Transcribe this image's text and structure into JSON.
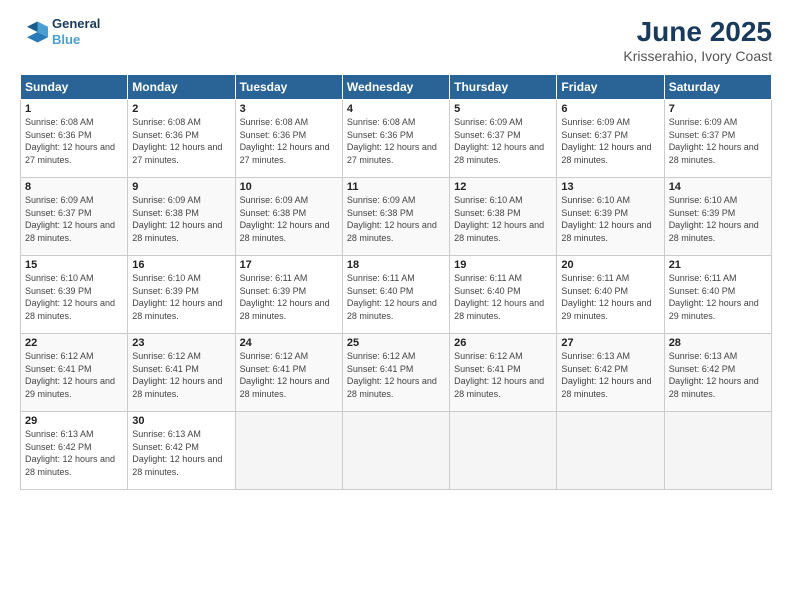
{
  "logo": {
    "line1": "General",
    "line2": "Blue"
  },
  "title": "June 2025",
  "subtitle": "Krisserahio, Ivory Coast",
  "days_of_week": [
    "Sunday",
    "Monday",
    "Tuesday",
    "Wednesday",
    "Thursday",
    "Friday",
    "Saturday"
  ],
  "weeks": [
    [
      {
        "num": "1",
        "sunrise": "6:08 AM",
        "sunset": "6:36 PM",
        "daylight": "12 hours and 27 minutes."
      },
      {
        "num": "2",
        "sunrise": "6:08 AM",
        "sunset": "6:36 PM",
        "daylight": "12 hours and 27 minutes."
      },
      {
        "num": "3",
        "sunrise": "6:08 AM",
        "sunset": "6:36 PM",
        "daylight": "12 hours and 27 minutes."
      },
      {
        "num": "4",
        "sunrise": "6:08 AM",
        "sunset": "6:36 PM",
        "daylight": "12 hours and 27 minutes."
      },
      {
        "num": "5",
        "sunrise": "6:09 AM",
        "sunset": "6:37 PM",
        "daylight": "12 hours and 28 minutes."
      },
      {
        "num": "6",
        "sunrise": "6:09 AM",
        "sunset": "6:37 PM",
        "daylight": "12 hours and 28 minutes."
      },
      {
        "num": "7",
        "sunrise": "6:09 AM",
        "sunset": "6:37 PM",
        "daylight": "12 hours and 28 minutes."
      }
    ],
    [
      {
        "num": "8",
        "sunrise": "6:09 AM",
        "sunset": "6:37 PM",
        "daylight": "12 hours and 28 minutes."
      },
      {
        "num": "9",
        "sunrise": "6:09 AM",
        "sunset": "6:38 PM",
        "daylight": "12 hours and 28 minutes."
      },
      {
        "num": "10",
        "sunrise": "6:09 AM",
        "sunset": "6:38 PM",
        "daylight": "12 hours and 28 minutes."
      },
      {
        "num": "11",
        "sunrise": "6:09 AM",
        "sunset": "6:38 PM",
        "daylight": "12 hours and 28 minutes."
      },
      {
        "num": "12",
        "sunrise": "6:10 AM",
        "sunset": "6:38 PM",
        "daylight": "12 hours and 28 minutes."
      },
      {
        "num": "13",
        "sunrise": "6:10 AM",
        "sunset": "6:39 PM",
        "daylight": "12 hours and 28 minutes."
      },
      {
        "num": "14",
        "sunrise": "6:10 AM",
        "sunset": "6:39 PM",
        "daylight": "12 hours and 28 minutes."
      }
    ],
    [
      {
        "num": "15",
        "sunrise": "6:10 AM",
        "sunset": "6:39 PM",
        "daylight": "12 hours and 28 minutes."
      },
      {
        "num": "16",
        "sunrise": "6:10 AM",
        "sunset": "6:39 PM",
        "daylight": "12 hours and 28 minutes."
      },
      {
        "num": "17",
        "sunrise": "6:11 AM",
        "sunset": "6:39 PM",
        "daylight": "12 hours and 28 minutes."
      },
      {
        "num": "18",
        "sunrise": "6:11 AM",
        "sunset": "6:40 PM",
        "daylight": "12 hours and 28 minutes."
      },
      {
        "num": "19",
        "sunrise": "6:11 AM",
        "sunset": "6:40 PM",
        "daylight": "12 hours and 28 minutes."
      },
      {
        "num": "20",
        "sunrise": "6:11 AM",
        "sunset": "6:40 PM",
        "daylight": "12 hours and 29 minutes."
      },
      {
        "num": "21",
        "sunrise": "6:11 AM",
        "sunset": "6:40 PM",
        "daylight": "12 hours and 29 minutes."
      }
    ],
    [
      {
        "num": "22",
        "sunrise": "6:12 AM",
        "sunset": "6:41 PM",
        "daylight": "12 hours and 29 minutes."
      },
      {
        "num": "23",
        "sunrise": "6:12 AM",
        "sunset": "6:41 PM",
        "daylight": "12 hours and 28 minutes."
      },
      {
        "num": "24",
        "sunrise": "6:12 AM",
        "sunset": "6:41 PM",
        "daylight": "12 hours and 28 minutes."
      },
      {
        "num": "25",
        "sunrise": "6:12 AM",
        "sunset": "6:41 PM",
        "daylight": "12 hours and 28 minutes."
      },
      {
        "num": "26",
        "sunrise": "6:12 AM",
        "sunset": "6:41 PM",
        "daylight": "12 hours and 28 minutes."
      },
      {
        "num": "27",
        "sunrise": "6:13 AM",
        "sunset": "6:42 PM",
        "daylight": "12 hours and 28 minutes."
      },
      {
        "num": "28",
        "sunrise": "6:13 AM",
        "sunset": "6:42 PM",
        "daylight": "12 hours and 28 minutes."
      }
    ],
    [
      {
        "num": "29",
        "sunrise": "6:13 AM",
        "sunset": "6:42 PM",
        "daylight": "12 hours and 28 minutes."
      },
      {
        "num": "30",
        "sunrise": "6:13 AM",
        "sunset": "6:42 PM",
        "daylight": "12 hours and 28 minutes."
      },
      null,
      null,
      null,
      null,
      null
    ]
  ]
}
